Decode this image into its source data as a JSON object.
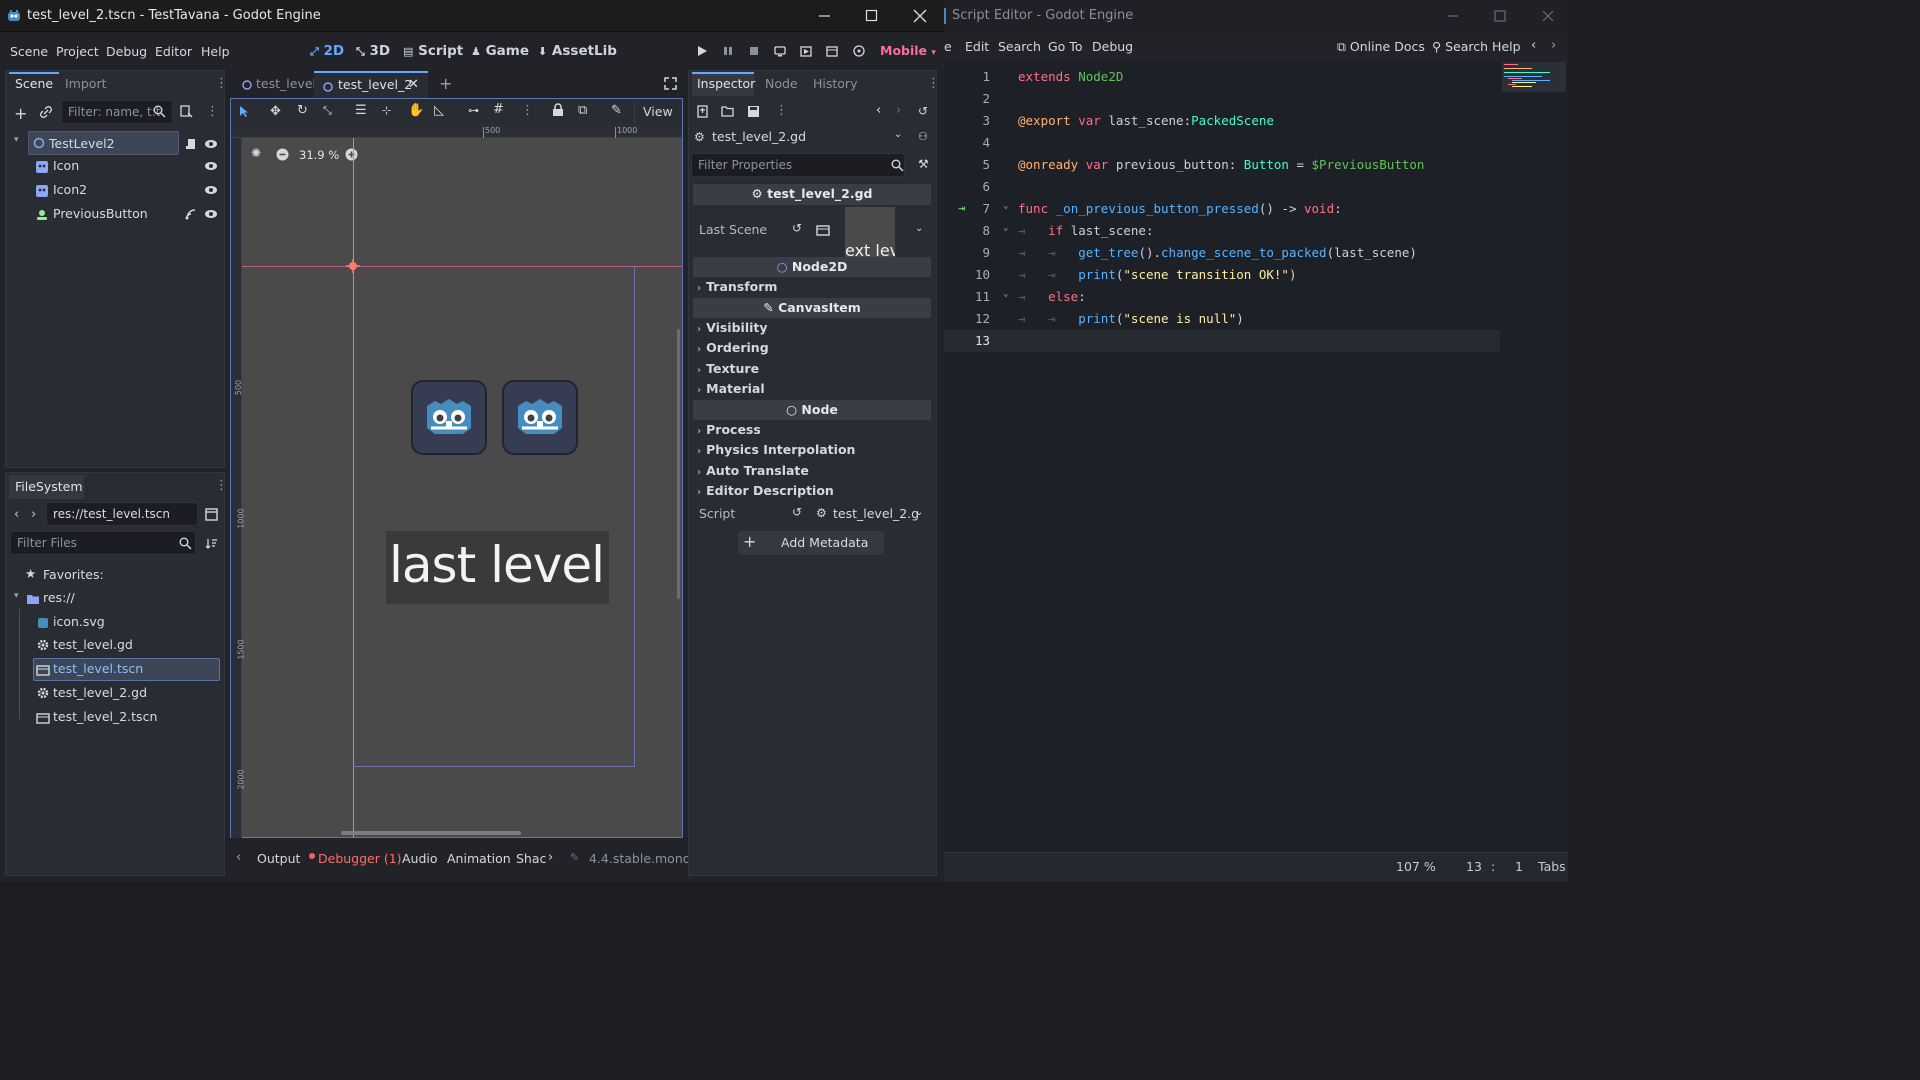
{
  "godot": {
    "title": "test_level_2.tscn - TestTavana - Godot Engine",
    "menu": [
      "Scene",
      "Project",
      "Debug",
      "Editor",
      "Help"
    ],
    "workspaces": [
      "2D",
      "3D",
      "Script",
      "Game",
      "AssetLib"
    ],
    "renderer": "Mobile",
    "scene_dock": {
      "tabs": [
        "Scene",
        "Import"
      ],
      "filter_placeholder": "Filter: name, t:t",
      "nodes": [
        {
          "label": "TestLevel2",
          "icon": "node2d-icon"
        },
        {
          "label": "Icon",
          "icon": "sprite-icon"
        },
        {
          "label": "Icon2",
          "icon": "sprite-icon"
        },
        {
          "label": "PreviousButton",
          "icon": "button-icon"
        }
      ]
    },
    "filesystem": {
      "tab": "FileSystem",
      "path": "res://test_level.tscn",
      "filter_placeholder": "Filter Files",
      "favorites": "Favorites:",
      "root": "res://",
      "files": [
        "icon.svg",
        "test_level.gd",
        "test_level.tscn",
        "test_level_2.gd",
        "test_level_2.tscn"
      ],
      "selected": "test_level.tscn"
    },
    "viewport": {
      "tabs": [
        "test_level",
        "test_level_2"
      ],
      "active_tab": "test_level_2",
      "zoom": "31.9 %",
      "view_menu": "View",
      "ruler_top": [
        "500",
        "1000"
      ],
      "ruler_left": [
        "500",
        "1000",
        "1500",
        "2000"
      ],
      "label_text": "last level"
    },
    "bottom_panel": {
      "tabs": [
        "Output",
        "Debugger (1)",
        "Audio",
        "Animation",
        "Shac"
      ],
      "version": "4.4.stable.mono"
    },
    "inspector": {
      "tabs": [
        "Inspector",
        "Node",
        "History"
      ],
      "resource": "test_level_2.gd",
      "filter_placeholder": "Filter Properties",
      "script_section": "test_level_2.gd",
      "last_scene_label": "Last Scene",
      "last_scene_preview": "ext lev",
      "sections": {
        "node2d": "Node2D",
        "canvasitem": "CanvasItem",
        "node": "Node"
      },
      "node2d_groups": [
        "Transform"
      ],
      "canvas_groups": [
        "Visibility",
        "Ordering",
        "Texture",
        "Material"
      ],
      "node_groups": [
        "Process",
        "Physics Interpolation",
        "Auto Translate",
        "Editor Description"
      ],
      "script_label": "Script",
      "script_value": "test_level_2.g",
      "add_metadata": "Add Metadata"
    }
  },
  "script_editor": {
    "title": "Script Editor - Godot Engine",
    "menu": [
      "e",
      "Edit",
      "Search",
      "Go To",
      "Debug"
    ],
    "online_docs": "Online Docs",
    "search_help": "Search Help",
    "code": [
      "extends Node2D",
      "",
      "@export var last_scene:PackedScene",
      "",
      "@onready var previous_button: Button = $PreviousButton",
      "",
      "func _on_previous_button_pressed() -> void:",
      "if last_scene:",
      "get_tree().change_scene_to_packed(last_scene)",
      "print(\"scene transition OK!\")",
      "else:",
      "print(\"scene is null\")",
      ""
    ],
    "status": {
      "zoom": "107 %",
      "line": "13",
      "col": "1",
      "indent": "Tabs"
    }
  },
  "colors": {
    "accent": "#64a8ff",
    "keyword": "#ff7085",
    "string": "#ffeda1",
    "type": "#42ffc2",
    "function": "#57b3ff",
    "error": "#ff5d5d"
  }
}
